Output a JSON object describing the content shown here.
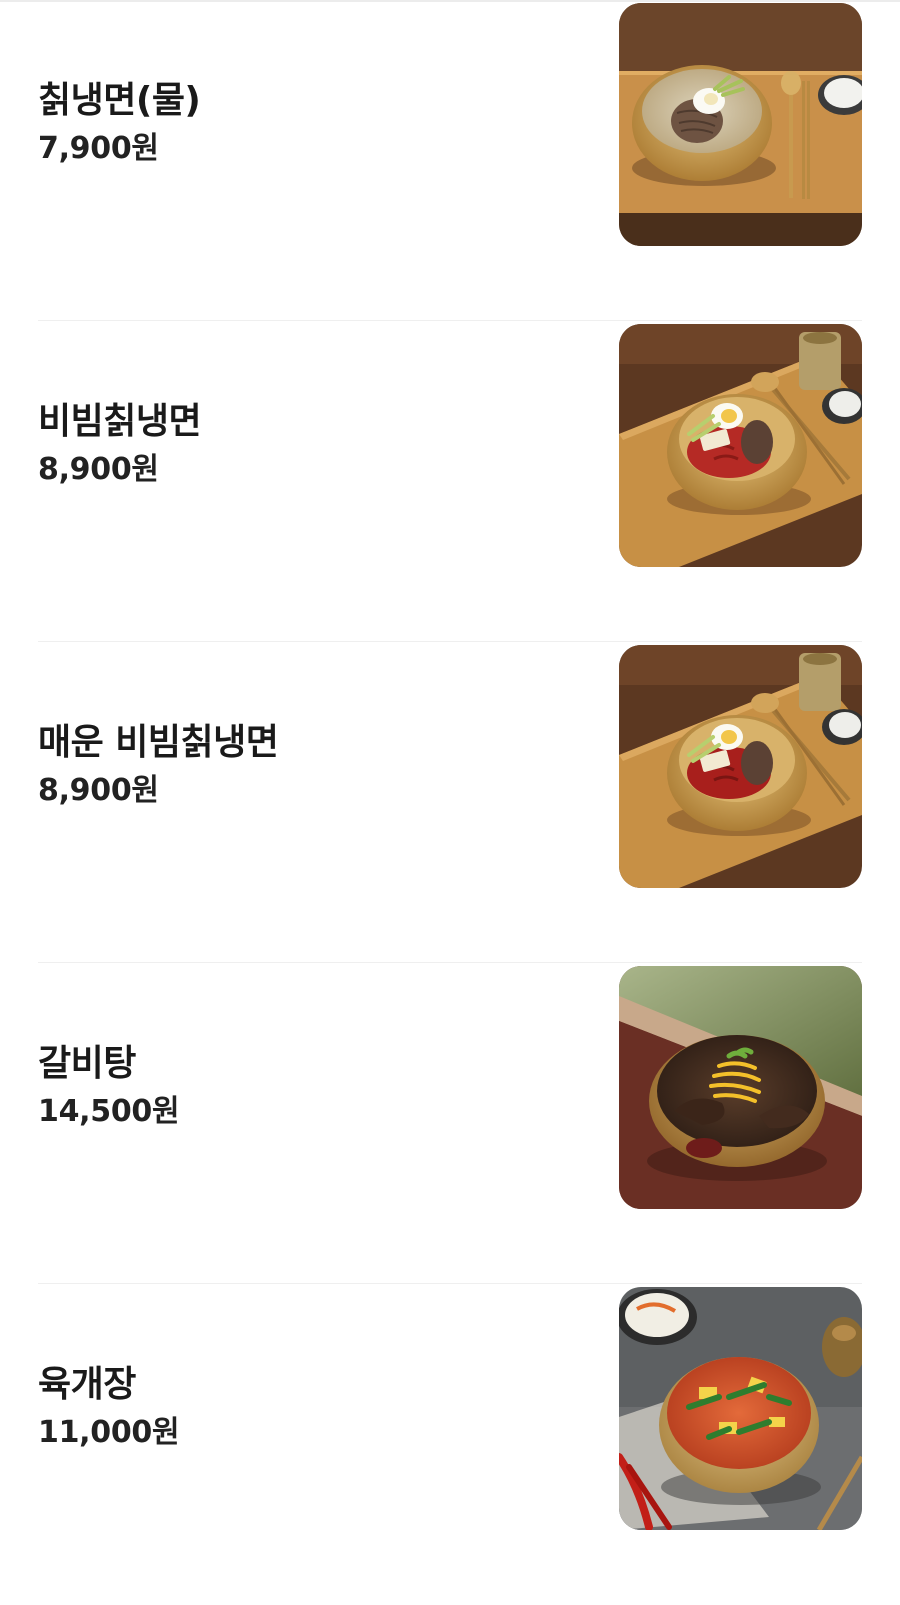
{
  "menu": {
    "items": [
      {
        "name": "칡냉면(물)",
        "price": "7,900원",
        "photo": "mul-naengmyeon-photo"
      },
      {
        "name": "비빔칡냉면",
        "price": "8,900원",
        "photo": "bibim-naengmyeon-photo"
      },
      {
        "name": "매운 비빔칡냉면",
        "price": "8,900원",
        "photo": "spicy-bibim-naengmyeon-photo"
      },
      {
        "name": "갈비탕",
        "price": "14,500원",
        "photo": "galbitang-photo"
      },
      {
        "name": "육개장",
        "price": "11,000원",
        "photo": "yukgaejang-photo"
      }
    ]
  }
}
